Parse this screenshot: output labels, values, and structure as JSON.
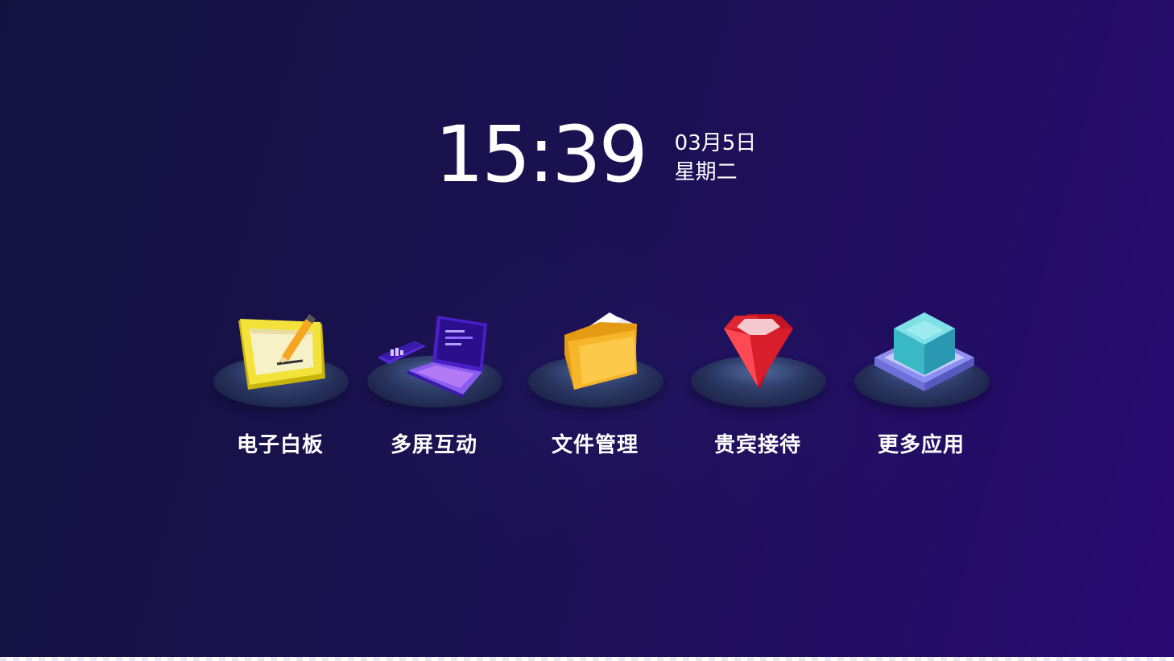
{
  "clock": {
    "time": "15:39",
    "date": "03月5日",
    "weekday": "星期二"
  },
  "apps": [
    {
      "label": "电子白板",
      "icon": "whiteboard-pencil-icon"
    },
    {
      "label": "多屏互动",
      "icon": "laptop-phone-icon"
    },
    {
      "label": "文件管理",
      "icon": "folder-icon"
    },
    {
      "label": "贵宾接待",
      "icon": "ruby-gem-icon"
    },
    {
      "label": "更多应用",
      "icon": "cube-stack-icon"
    }
  ],
  "colors": {
    "background_start": "#13123f",
    "background_end": "#2a0a72",
    "text": "#ffffff"
  }
}
